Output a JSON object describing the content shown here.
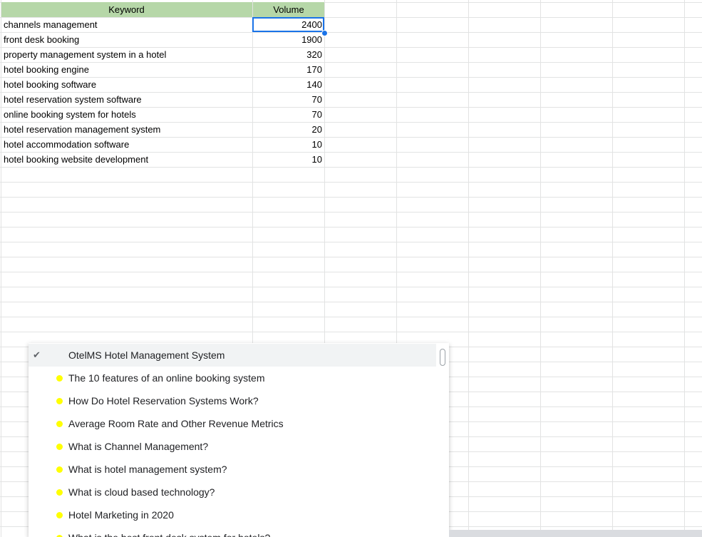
{
  "headers": {
    "keyword": "Keyword",
    "volume": "Volume"
  },
  "rows": [
    {
      "keyword": "channels management",
      "volume": "2400"
    },
    {
      "keyword": "front desk booking",
      "volume": "1900"
    },
    {
      "keyword": "property management system in a hotel",
      "volume": "320"
    },
    {
      "keyword": "hotel booking engine",
      "volume": "170"
    },
    {
      "keyword": "hotel booking software",
      "volume": "140"
    },
    {
      "keyword": "hotel reservation system software",
      "volume": "70"
    },
    {
      "keyword": "online booking system for hotels",
      "volume": "70"
    },
    {
      "keyword": "hotel reservation management system",
      "volume": "20"
    },
    {
      "keyword": "hotel accommodation software",
      "volume": "10"
    },
    {
      "keyword": "hotel booking website development",
      "volume": "10"
    }
  ],
  "dropdown": {
    "items": [
      {
        "label": "OtelMS Hotel Management System",
        "selected": true,
        "icon": "check-icon"
      },
      {
        "label": "The 10 features of an online booking system",
        "selected": false,
        "icon": "yellow-dot-icon"
      },
      {
        "label": "How Do Hotel Reservation Systems Work?",
        "selected": false,
        "icon": "yellow-dot-icon"
      },
      {
        "label": "Average Room Rate and Other Revenue Metrics",
        "selected": false,
        "icon": "yellow-dot-icon"
      },
      {
        "label": "What is Channel Management?",
        "selected": false,
        "icon": "yellow-dot-icon"
      },
      {
        "label": "What is hotel management system?",
        "selected": false,
        "icon": "yellow-dot-icon"
      },
      {
        "label": "What is cloud based technology?",
        "selected": false,
        "icon": "yellow-dot-icon"
      },
      {
        "label": "Hotel Marketing in 2020",
        "selected": false,
        "icon": "yellow-dot-icon"
      },
      {
        "label": "What is the best front desk system for hotels?",
        "selected": false,
        "icon": "yellow-dot-icon"
      }
    ]
  },
  "colors": {
    "header_fill": "#b6d7a8",
    "selection": "#1a73e8",
    "dot": "#ffff00",
    "gridline": "#e2e3e3"
  }
}
